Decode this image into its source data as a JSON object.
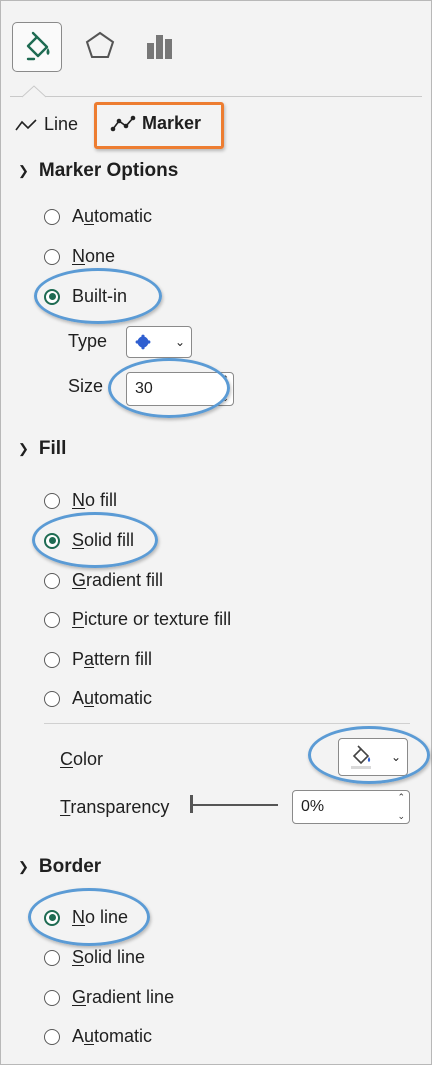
{
  "tabs": {
    "line": "Line",
    "marker": "Marker"
  },
  "marker_options": {
    "title": "Marker Options",
    "radios": [
      {
        "pre": "A",
        "key": "u",
        "post": "tomatic",
        "checked": false
      },
      {
        "pre": "",
        "key": "N",
        "post": "one",
        "checked": false
      },
      {
        "pre": "",
        "key": "",
        "post": "Built-in",
        "checked": true
      }
    ],
    "type_label": "Type",
    "size_label": "Size",
    "size_value": "30"
  },
  "fill": {
    "title": "Fill",
    "radios": [
      {
        "pre": "",
        "key": "N",
        "post": "o fill",
        "checked": false
      },
      {
        "pre": "",
        "key": "S",
        "post": "olid fill",
        "checked": true
      },
      {
        "pre": "",
        "key": "G",
        "post": "radient fill",
        "checked": false
      },
      {
        "pre": "",
        "key": "P",
        "post": "icture or texture fill",
        "checked": false
      },
      {
        "pre": "P",
        "key": "a",
        "post": "ttern fill",
        "checked": false
      },
      {
        "pre": "A",
        "key": "u",
        "post": "tomatic",
        "checked": false
      }
    ],
    "color_label_pre": "",
    "color_label_key": "C",
    "color_label_post": "olor",
    "transparency_pre": "",
    "transparency_key": "T",
    "transparency_post": "ransparency",
    "transparency_value": "0%"
  },
  "border": {
    "title": "Border",
    "radios": [
      {
        "pre": "",
        "key": "N",
        "post": "o line",
        "checked": true
      },
      {
        "pre": "",
        "key": "S",
        "post": "olid line",
        "checked": false
      },
      {
        "pre": "",
        "key": "G",
        "post": "radient line",
        "checked": false
      },
      {
        "pre": "A",
        "key": "u",
        "post": "tomatic",
        "checked": false
      }
    ]
  },
  "colors": {
    "accent": "#1e6b52",
    "highlight": "#5b9bd5",
    "callout": "#ed7d31",
    "marker": "#2f5fd0"
  }
}
